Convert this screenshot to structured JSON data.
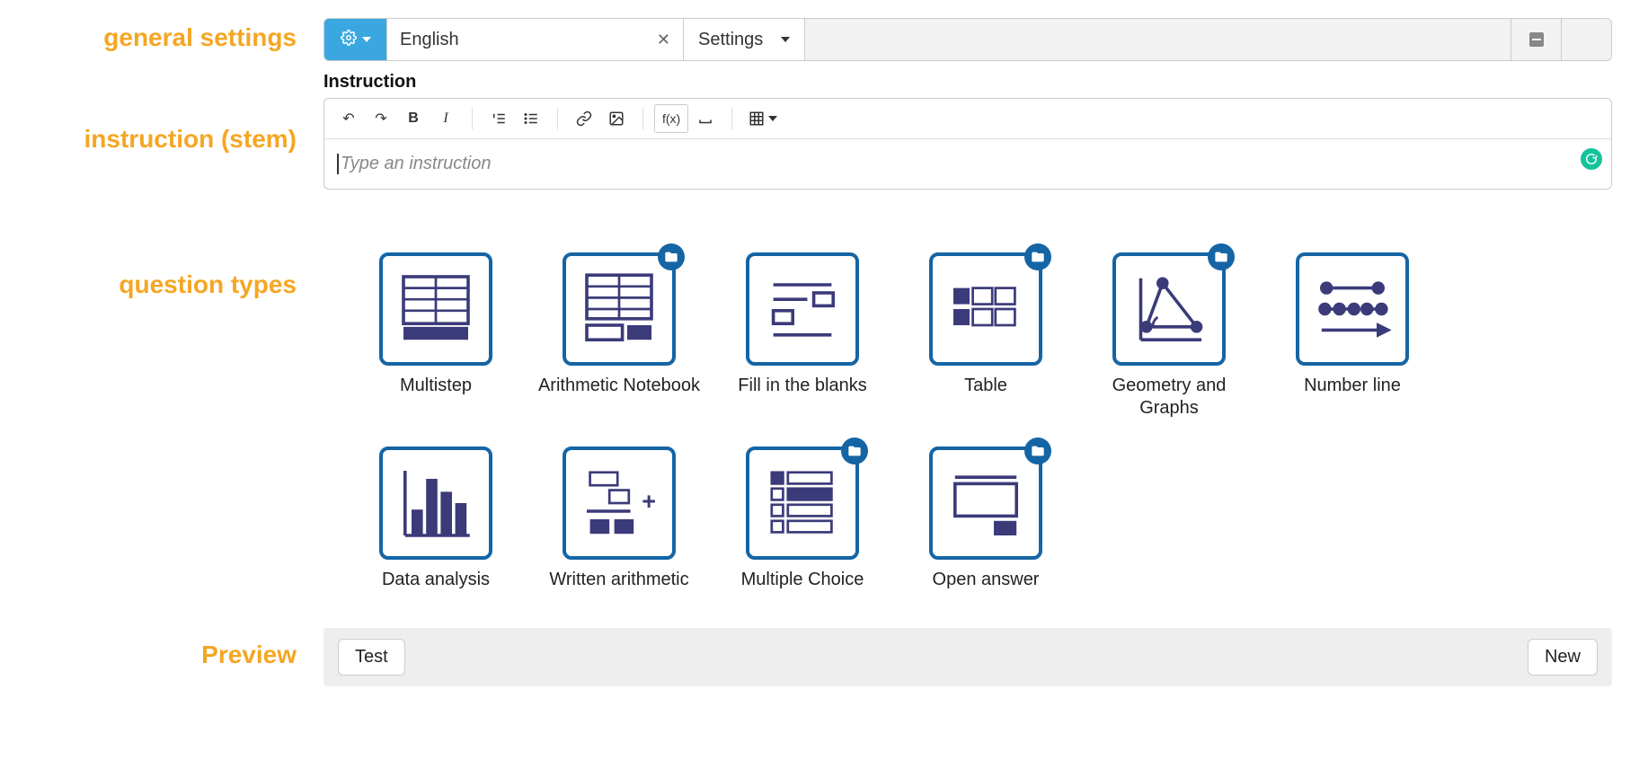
{
  "labels": {
    "general_settings": "general settings",
    "instruction": "instruction (stem)",
    "question_types": "question types",
    "preview": "Preview"
  },
  "topbar": {
    "language": "English",
    "settings_label": "Settings"
  },
  "instruction": {
    "heading": "Instruction",
    "placeholder": "Type an instruction",
    "fx_label": "f(x)"
  },
  "qtypes": [
    {
      "label": "Multistep",
      "folder": false,
      "icon": "multistep"
    },
    {
      "label": "Arithmetic Notebook",
      "folder": true,
      "icon": "arith-nb"
    },
    {
      "label": "Fill in the blanks",
      "folder": false,
      "icon": "blanks"
    },
    {
      "label": "Table",
      "folder": true,
      "icon": "table"
    },
    {
      "label": "Geometry and Graphs",
      "folder": true,
      "icon": "geo"
    },
    {
      "label": "Number line",
      "folder": false,
      "icon": "numline"
    },
    {
      "label": "Data analysis",
      "folder": false,
      "icon": "bars"
    },
    {
      "label": "Written arithmetic",
      "folder": false,
      "icon": "written"
    },
    {
      "label": "Multiple Choice",
      "folder": true,
      "icon": "mc"
    },
    {
      "label": "Open answer",
      "folder": true,
      "icon": "open"
    }
  ],
  "preview": {
    "test": "Test",
    "new": "New"
  }
}
